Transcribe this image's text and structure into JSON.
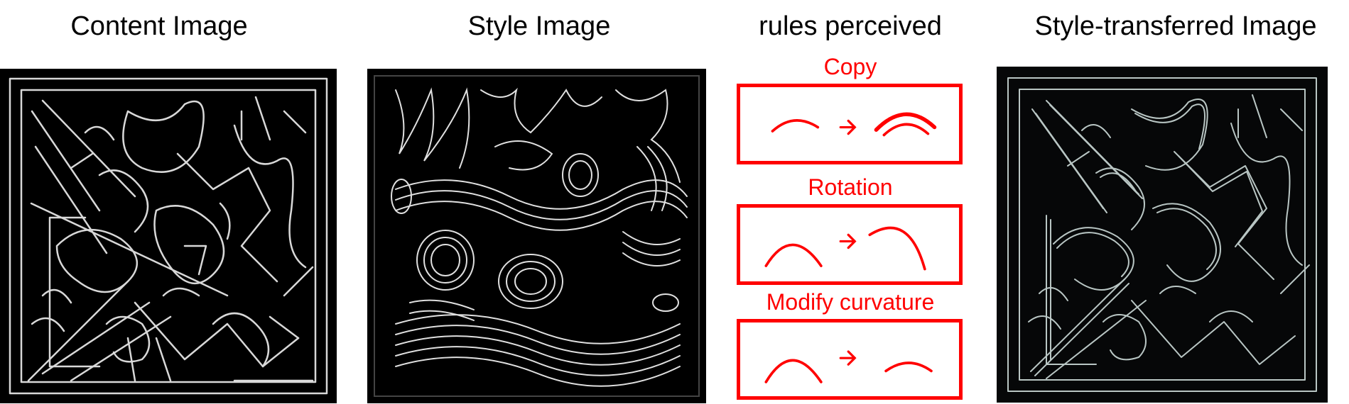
{
  "headings": {
    "content": "Content Image",
    "style": "Style Image",
    "rules": "rules perceived",
    "transferred": "Style-transferred Image"
  },
  "rules": [
    {
      "title": "Copy",
      "icon": "arc-copy-icon"
    },
    {
      "title": "Rotation",
      "icon": "arc-rotation-icon"
    },
    {
      "title": "Modify curvature",
      "icon": "arc-curvature-icon"
    }
  ],
  "colors": {
    "rule_accent": "#ff0000",
    "panel_background": "#000000",
    "line_content": "#d8d8d8",
    "line_style": "#e0e0e0",
    "line_transferred": "#b9c6c4"
  }
}
